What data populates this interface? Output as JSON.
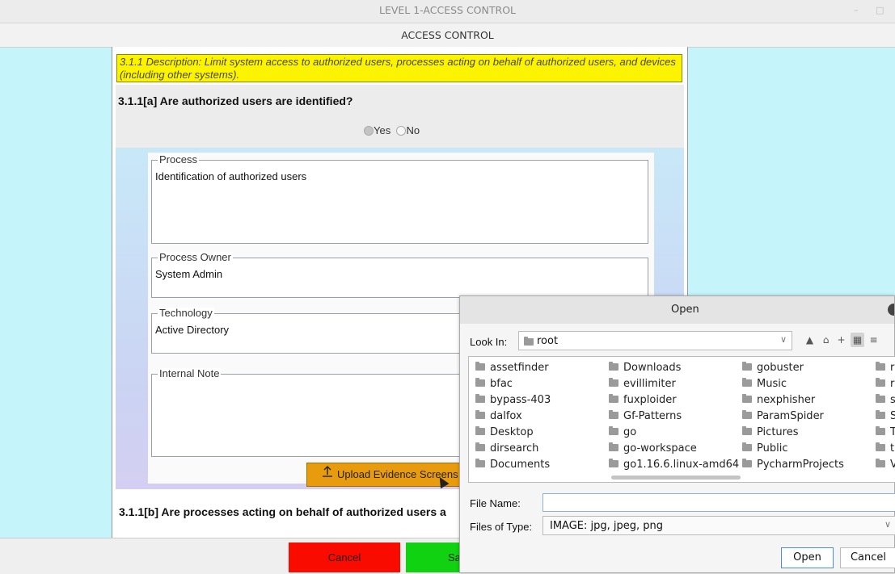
{
  "window": {
    "title": "LEVEL 1-ACCESS CONTROL",
    "subtitle": "ACCESS CONTROL",
    "controls": [
      "–",
      "□"
    ]
  },
  "description": "3.1.1 Description: Limit system access to authorized users, processes acting on behalf of authorized users, and devices (including other systems).",
  "question": {
    "title": "3.1.1[a] Are authorized users are identified?",
    "options": [
      "Yes",
      "No"
    ],
    "selected": "Yes"
  },
  "fields": {
    "process": {
      "label": "Process",
      "value": "Identification of authorized users"
    },
    "process_owner": {
      "label": "Process Owner",
      "value": "System Admin"
    },
    "technology": {
      "label": "Technology",
      "value": "Active Directory"
    },
    "internal_note": {
      "label": "Internal Note",
      "value": ""
    }
  },
  "upload_button": "Upload Evidence Screens",
  "question2_title": "3.1.1[b] Are processes acting on behalf of authorized users a",
  "bottom": {
    "cancel": "Cancel",
    "save": "Sa"
  },
  "dialog": {
    "title": "Open",
    "look_in_label": "Look In:",
    "look_in_value": "root",
    "columns": [
      [
        "assetfinder",
        "bfac",
        "bypass-403",
        "dalfox",
        "Desktop",
        "dirsearch",
        "Documents"
      ],
      [
        "Downloads",
        "evillimiter",
        "fuxploider",
        "Gf-Patterns",
        "go",
        "go-workspace",
        "go1.16.6.linux-amd64"
      ],
      [
        "gobuster",
        "Music",
        "nexphisher",
        "ParamSpider",
        "Pictures",
        "Public",
        "PycharmProjects"
      ],
      [
        "r",
        "r",
        "s",
        "S",
        "T",
        "t",
        "V"
      ]
    ],
    "file_name_label": "File Name:",
    "file_name_value": "",
    "file_type_label": "Files of Type:",
    "file_type_value": "IMAGE: jpg, jpeg, png",
    "open_button": "Open",
    "cancel_button": "Cancel"
  }
}
